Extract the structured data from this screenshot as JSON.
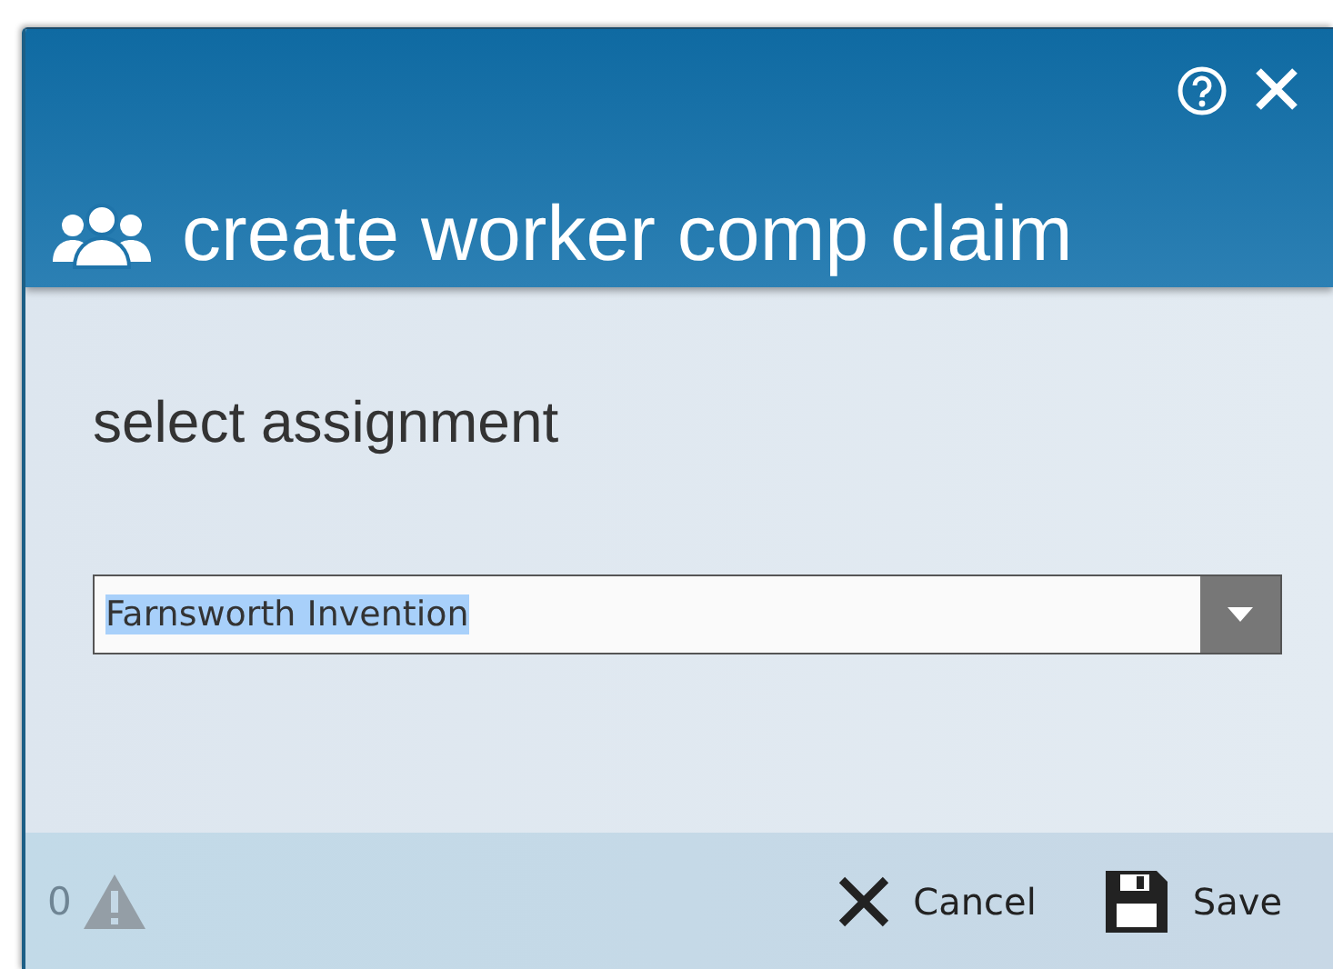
{
  "dialog": {
    "title": "create worker comp claim"
  },
  "prompt": "select assignment",
  "assignment_field": {
    "value": "Farnsworth Invention",
    "text_selected": true
  },
  "footer": {
    "warning_count": "0",
    "buttons": [
      {
        "kind": "cancel",
        "label": "Cancel"
      },
      {
        "kind": "save",
        "label": "Save"
      }
    ]
  }
}
